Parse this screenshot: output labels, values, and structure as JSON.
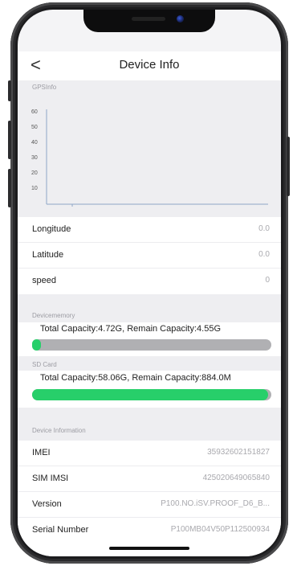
{
  "nav": {
    "back": "<",
    "title": "Device Info"
  },
  "gps": {
    "section_label": "GPSInfo",
    "y_ticks": [
      "60",
      "50",
      "40",
      "30",
      "20",
      "10"
    ]
  },
  "location": [
    {
      "label": "Longitude",
      "value": "0.0"
    },
    {
      "label": "Latitude",
      "value": "0.0"
    },
    {
      "label": "speed",
      "value": "0"
    }
  ],
  "device_memory": {
    "section_label": "Devicememory",
    "capacity_text": "Total Capacity:4.72G, Remain Capacity:4.55G",
    "used_fraction": 0.036
  },
  "sd_card": {
    "section_label": "SD Card",
    "capacity_text": "Total Capacity:58.06G, Remain Capacity:884.0M",
    "used_fraction": 0.985
  },
  "device_information": {
    "section_label": "Device Information",
    "rows": [
      {
        "label": "IMEI",
        "value": "35932602151827"
      },
      {
        "label": "SIM IMSI",
        "value": "425020649065840"
      },
      {
        "label": "Version",
        "value": "P100.NO.iSV.PROOF_D6_B..."
      },
      {
        "label": "Serial Number",
        "value": "P100MB04V50P112500934"
      }
    ]
  },
  "colors": {
    "accent_green": "#27cf6a",
    "track_gray": "#b0b0b3"
  }
}
